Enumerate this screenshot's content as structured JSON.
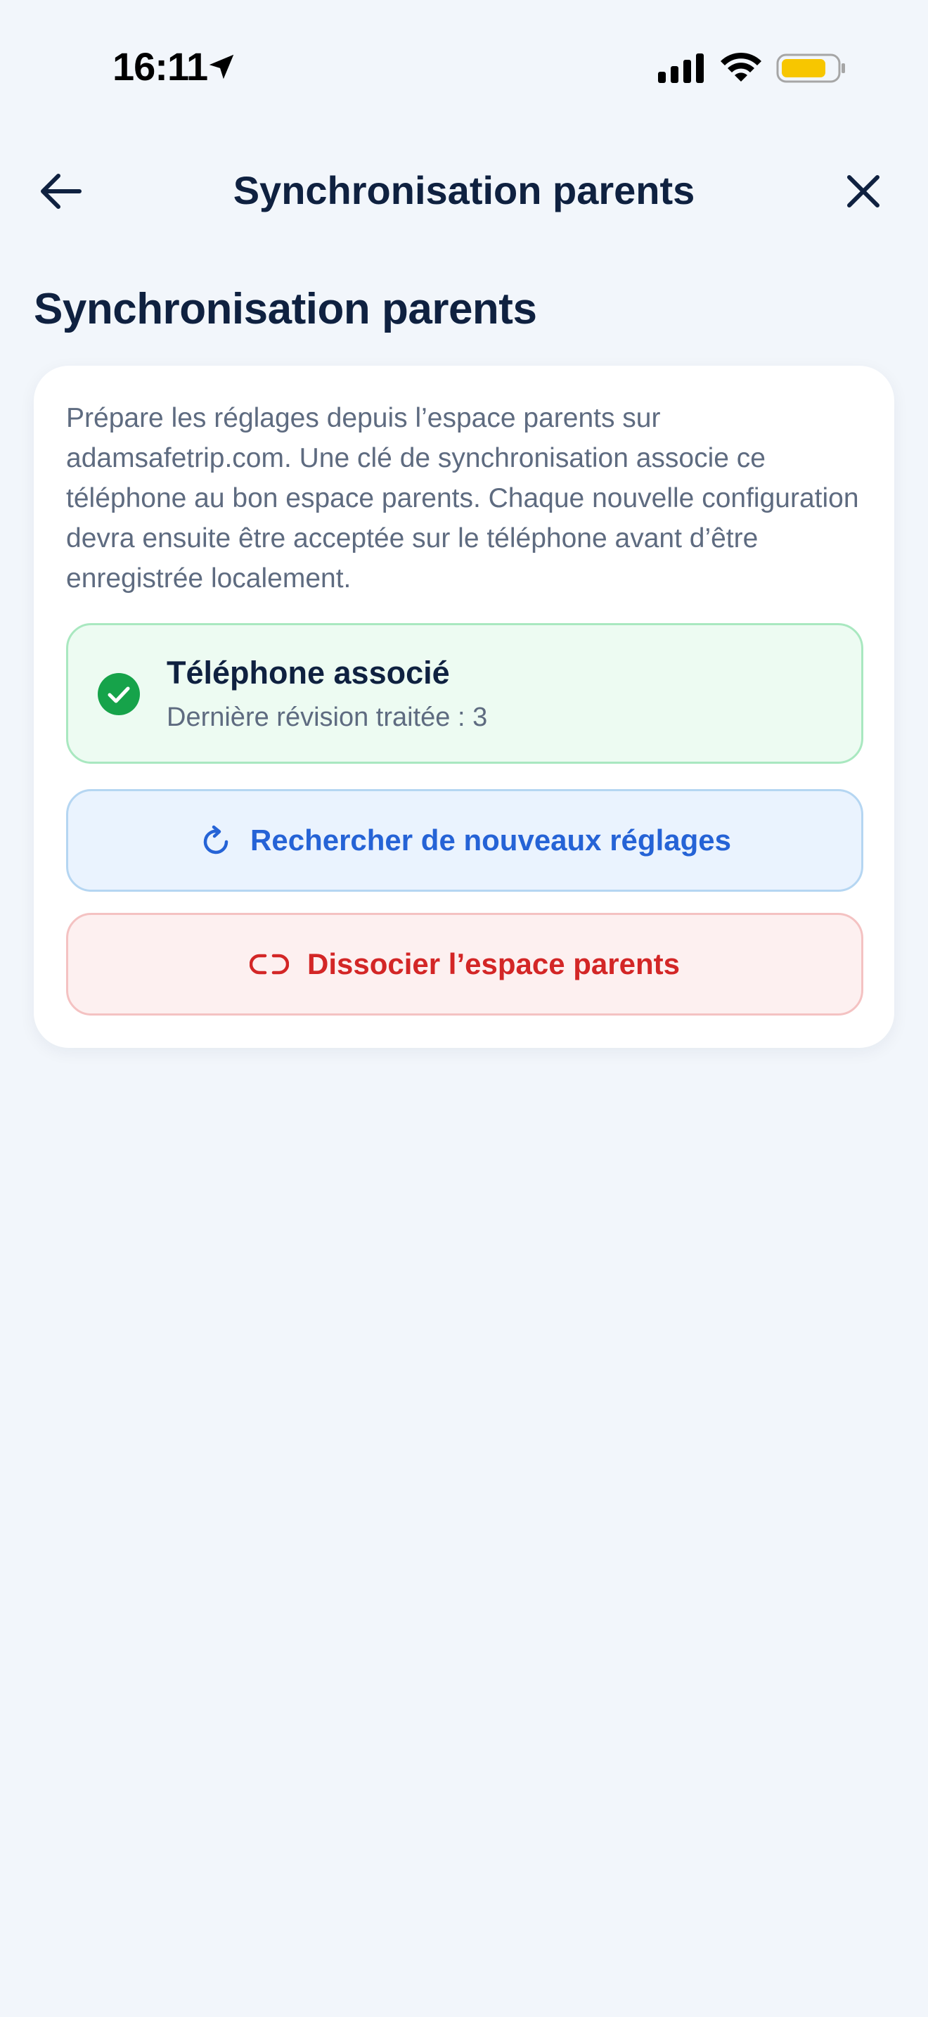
{
  "status_bar": {
    "time": "16:11",
    "icons": [
      "location-arrow-icon",
      "cellular-signal-icon",
      "wifi-icon",
      "battery-icon"
    ],
    "battery_color": "#f7c600"
  },
  "nav": {
    "title": "Synchronisation parents",
    "back_icon": "arrow-left-icon",
    "close_icon": "close-icon"
  },
  "page": {
    "title": "Synchronisation parents"
  },
  "card": {
    "description": "Prépare les réglages depuis l’espace parents sur adamsafetrip.com. Une clé de synchronisation associe ce téléphone au bon espace parents. Chaque nouvelle configuration devra ensuite être acceptée sur le téléphone avant d’être enregistrée localement.",
    "status": {
      "icon": "check-circle-icon",
      "title": "Téléphone associé",
      "subtitle": "Dernière révision traitée : 3"
    },
    "sync_button": {
      "icon": "refresh-icon",
      "label": "Rechercher de nouveaux réglages"
    },
    "dissociate_button": {
      "icon": "unlink-icon",
      "label": "Dissocier l’espace parents"
    }
  },
  "colors": {
    "background": "#f2f6fb",
    "primary_text": "#0f2140",
    "secondary_text": "#5e6b80",
    "success": "#16a34a",
    "accent_blue": "#2563d6",
    "danger_red": "#d32626"
  }
}
